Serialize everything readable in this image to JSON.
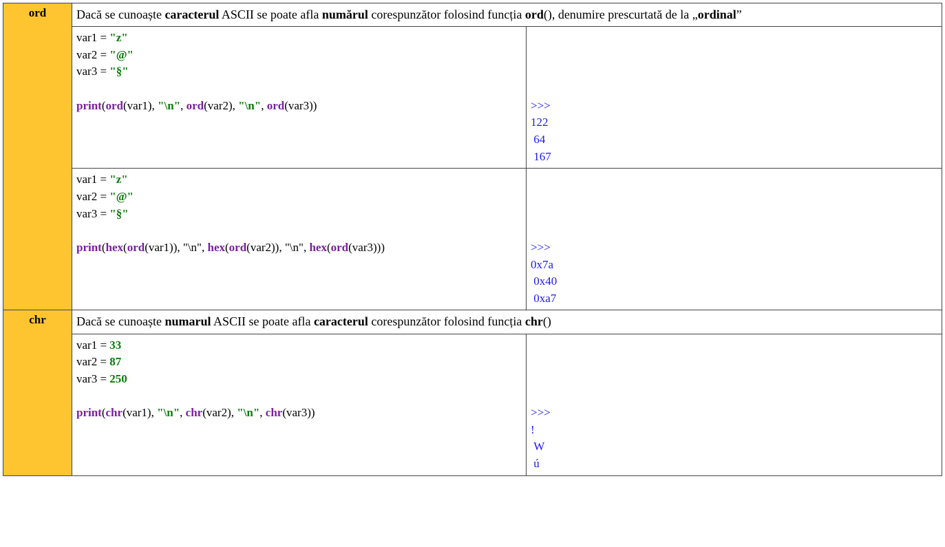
{
  "ord": {
    "label": "ord",
    "desc": {
      "t1": "Dacă se cunoaște ",
      "b1": "caracterul",
      "t2": " ASCII se poate afla ",
      "b2": "numărul",
      "t3": " corespunzător folosind funcția ",
      "b3": "ord",
      "t4": "(), denumire prescurtată de la „",
      "b4": "ordinal",
      "t5": "”"
    },
    "ex1": {
      "code": {
        "l1a": "var1 = ",
        "l1b": "\"z\"",
        "l2a": "var2 = ",
        "l2b": "\"@\"",
        "l3a": "var3 = ",
        "l3b": "\"§\"",
        "p_print": "print",
        "p_open": "(",
        "p_ord1": "ord",
        "p_o1a": "(var1), ",
        "p_s1": "\"\\n\"",
        "p_o1b": ", ",
        "p_ord2": "ord",
        "p_o2a": "(var2), ",
        "p_s2": "\"\\n\"",
        "p_o2b": ", ",
        "p_ord3": "ord",
        "p_o3a": "(var3))"
      },
      "out": ">>> \n122\n 64\n 167"
    },
    "ex2": {
      "code": {
        "l1a": "var1 = ",
        "l1b": "\"z\"",
        "l2a": "var2 = ",
        "l2b": "\"@\"",
        "l3a": "var3 = ",
        "l3b": "\"§\"",
        "p_print": "print",
        "p_open": "(",
        "p_hex1": "hex",
        "p_h1a": "(",
        "p_ord1": "ord",
        "p_o1": "(var1)), \"\\n\", ",
        "p_hex2": "hex",
        "p_h2a": "(",
        "p_ord2": "ord",
        "p_o2": "(var2)), \"\\n\", ",
        "p_hex3": "hex",
        "p_h3a": "(",
        "p_ord3": "ord",
        "p_o3": "(var3)))"
      },
      "out": ">>> \n0x7a\n 0x40\n 0xa7"
    }
  },
  "chr": {
    "label": "chr",
    "desc": {
      "t1": "Dacă se cunoaște ",
      "b1": "numarul",
      "t2": " ASCII se poate afla ",
      "b2": "caracterul",
      "t3": " corespunzător folosind funcția ",
      "b3": "chr",
      "t4": "()"
    },
    "ex1": {
      "code": {
        "l1a": "var1 = ",
        "l1b": "33",
        "l2a": "var2 = ",
        "l2b": "87",
        "l3a": "var3 = ",
        "l3b": "250",
        "p_print": "print",
        "p_open": "(",
        "p_chr1": "chr",
        "p_o1a": "(var1), ",
        "p_s1": "\"\\n\"",
        "p_o1b": ", ",
        "p_chr2": "chr",
        "p_o2a": "(var2), ",
        "p_s2": "\"\\n\"",
        "p_o2b": ", ",
        "p_chr3": "chr",
        "p_o3a": "(var3))"
      },
      "out": ">>> \n!\n W\n ú"
    }
  }
}
